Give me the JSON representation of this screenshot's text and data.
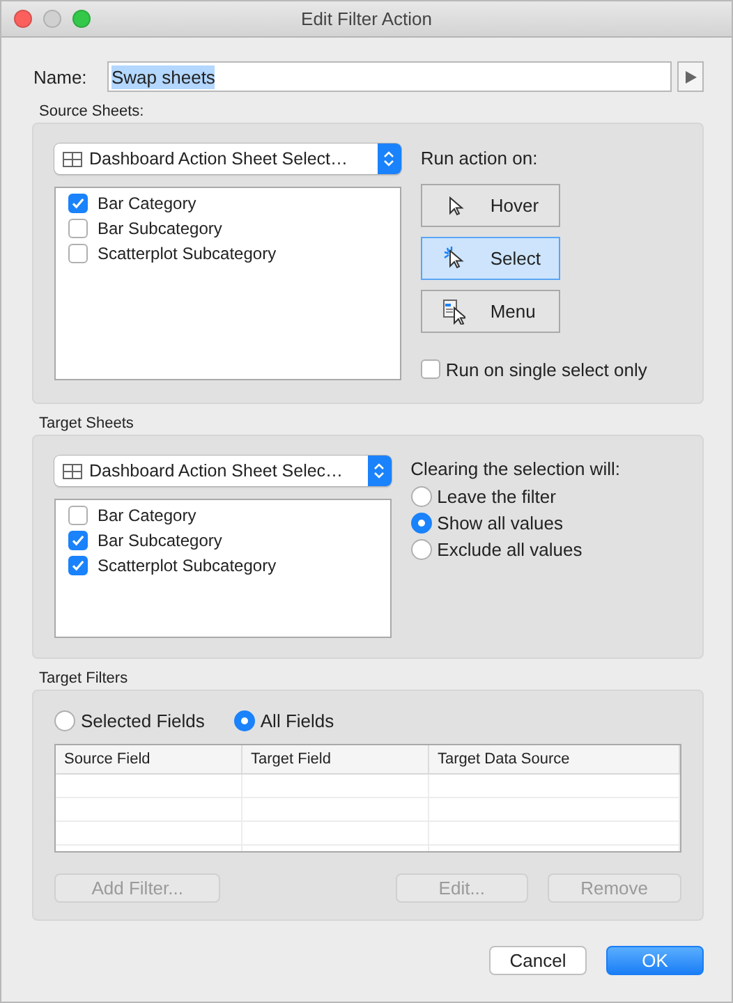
{
  "window": {
    "title": "Edit Filter Action"
  },
  "name": {
    "label": "Name:",
    "value": "Swap sheets",
    "value_selected": true
  },
  "source": {
    "title": "Source Sheets:",
    "dropdown": "Dashboard Action Sheet Select…",
    "sheets": [
      {
        "label": "Bar Category",
        "checked": true
      },
      {
        "label": "Bar Subcategory",
        "checked": false
      },
      {
        "label": "Scatterplot Subcategory",
        "checked": false
      }
    ],
    "run_on_label": "Run action on:",
    "run_on": [
      {
        "label": "Hover",
        "kind": "hover",
        "selected": false
      },
      {
        "label": "Select",
        "kind": "select",
        "selected": true
      },
      {
        "label": "Menu",
        "kind": "menu",
        "selected": false
      }
    ],
    "single_select": {
      "label": "Run on single select only",
      "checked": false
    }
  },
  "target": {
    "title": "Target Sheets",
    "dropdown": "Dashboard Action Sheet Selec…",
    "sheets": [
      {
        "label": "Bar Category",
        "checked": false
      },
      {
        "label": "Bar Subcategory",
        "checked": true
      },
      {
        "label": "Scatterplot Subcategory",
        "checked": true
      }
    ],
    "clearing_label": "Clearing the selection will:",
    "clearing": [
      {
        "label": "Leave the filter",
        "selected": false
      },
      {
        "label": "Show all values",
        "selected": true
      },
      {
        "label": "Exclude all values",
        "selected": false
      }
    ]
  },
  "filters": {
    "title": "Target Filters",
    "scope": [
      {
        "label": "Selected Fields",
        "selected": false
      },
      {
        "label": "All Fields",
        "selected": true
      }
    ],
    "columns": [
      "Source Field",
      "Target Field",
      "Target Data Source"
    ],
    "buttons": [
      {
        "label": "Add Filter...",
        "disabled": true
      },
      {
        "label": "Edit...",
        "disabled": true
      },
      {
        "label": "Remove",
        "disabled": true
      }
    ]
  },
  "footer": [
    {
      "label": "Cancel",
      "default": false
    },
    {
      "label": "OK",
      "default": true
    }
  ]
}
